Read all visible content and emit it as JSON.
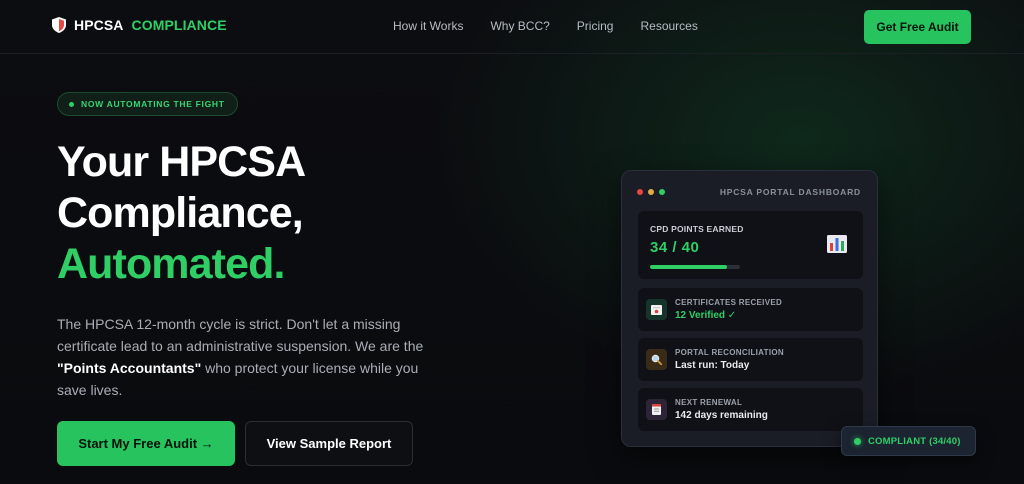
{
  "nav": {
    "brand": "HPCSA",
    "brand_accent": "COMPLIANCE",
    "logo_icon": "shield-icon",
    "links": [
      "How it Works",
      "Why BCC?",
      "Pricing",
      "Resources"
    ],
    "cta_label": "Get Free Audit"
  },
  "hero": {
    "pill_text": "NOW AUTOMATING THE FIGHT",
    "headline_line1": "Your HPCSA",
    "headline_line2": "Compliance,",
    "headline_line3": "Automated.",
    "lede_start": "The HPCSA 12-month cycle is strict. Don't let a missing certificate lead to an administrative suspension. We are the ",
    "lede_strong": "\"Points Accountants\"",
    "lede_end": " who protect your license while you save lives.",
    "primary_button": "Start My Free Audit →",
    "secondary_button": "View Sample Report"
  },
  "dashboard": {
    "title": "HPCSA PORTAL DASHBOARD",
    "window_dots": [
      "#e5483f",
      "#e8a93a",
      "#2fcf66"
    ],
    "cpd_label": "CPD POINTS EARNED",
    "cpd_value": "34 / 40",
    "cpd_progress": 0.85,
    "chart_icon": "bar-chart-icon",
    "rows": [
      {
        "icon": "certificate-icon",
        "label": "CERTIFICATES RECEIVED",
        "value": "12 Verified ✓",
        "highlight": true,
        "icon_bg": "#16352a"
      },
      {
        "icon": "magnifier-icon",
        "label": "PORTAL RECONCILIATION",
        "value": "Last run: Today",
        "highlight": false,
        "icon_bg": "#3a2a18"
      },
      {
        "icon": "document-icon",
        "label": "NEXT RENEWAL",
        "value": "142 days remaining",
        "highlight": false,
        "icon_bg": "#2c2538"
      }
    ]
  },
  "badge": {
    "text": "COMPLIANT (34/40)"
  },
  "colors": {
    "accent": "#2fcf66",
    "button_green": "#27c35f",
    "background": "#0a0b0e",
    "card": "#1a1d26"
  }
}
